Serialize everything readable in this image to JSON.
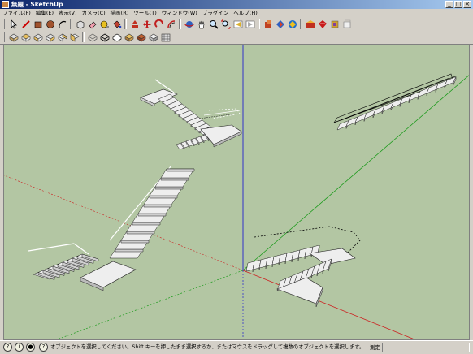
{
  "window": {
    "title": "無題 - SketchUp",
    "min_glyph": "_",
    "max_glyph": "□",
    "close_glyph": "×"
  },
  "menu": [
    "ファイル(F)",
    "編集(E)",
    "表示(V)",
    "カメラ(C)",
    "描画(R)",
    "ツール(T)",
    "ウィンドウ(W)",
    "プラグイン",
    "ヘルプ(H)"
  ],
  "status": {
    "message": "オブジェクトを選択してください。Shift キーを押したまま選択するか、またはマウスをドラッグして複数のオブジェクトを選択します。",
    "measurements_label": "測定",
    "measurements_value": ""
  },
  "colors": {
    "sky": "#b3c6a3",
    "axis_red": "#c22",
    "axis_green": "#1a9a1a",
    "axis_blue": "#2222cc",
    "stair_face": "#eeeeee",
    "stair_edge": "#222222"
  }
}
